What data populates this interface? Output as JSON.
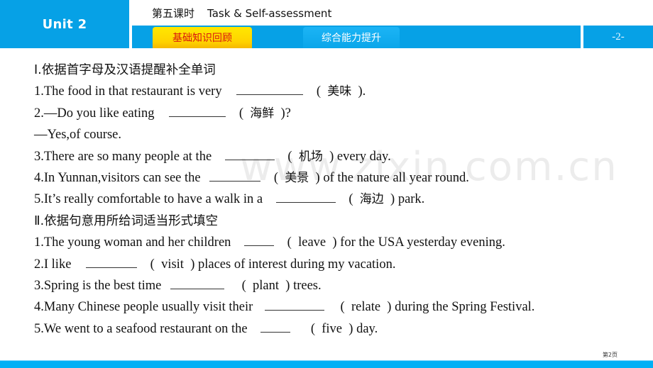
{
  "header": {
    "unit": "Unit 2",
    "lesson_cn": "第五课时",
    "lesson_en": "Task & Self-assessment",
    "tabs": [
      {
        "label": "基础知识回顾",
        "active": true
      },
      {
        "label": "综合能力提升",
        "active": false
      }
    ],
    "page_indicator": "-2-"
  },
  "section1": {
    "heading": "Ⅰ.依据首字母及汉语提醒补全单词",
    "items": [
      {
        "before": "1.The food in that restaurant is very",
        "hint": "美味",
        "after": "."
      },
      {
        "before": "2.—Do you like eating",
        "hint": "海鲜",
        "after": "?"
      },
      {
        "text": "—Yes,of course."
      },
      {
        "before": "3.There are so many people at the",
        "hint": "机场",
        "after": "every day."
      },
      {
        "before": "4.In Yunnan,visitors can see the",
        "hint": "美景",
        "after": "of the nature all year round."
      },
      {
        "before": "5.It’s really comfortable to have a walk in a",
        "hint": "海边",
        "after": "park."
      }
    ]
  },
  "section2": {
    "heading": "Ⅱ.依据句意用所给词适当形式填空",
    "items": [
      {
        "before": "1.The young woman and her children",
        "hint": "leave",
        "after": "for the USA yesterday evening."
      },
      {
        "before": "2.I like",
        "hint": "visit",
        "after": "places of interest during my vacation."
      },
      {
        "before": "3.Spring is the best time",
        "hint": "plant",
        "after": "trees."
      },
      {
        "before": "4.Many Chinese people usually visit their",
        "hint": "relate",
        "after": "during the Spring Festival."
      },
      {
        "before": "5.We went to a seafood restaurant on the",
        "hint": "five",
        "after": "day."
      }
    ]
  },
  "watermark": "www.zixin.com.cn",
  "footer": {
    "page_label": "第2页"
  },
  "colors": {
    "header_blue": "#06a1e6",
    "active_tab": "#ffd800",
    "active_tab_text": "#d8150f",
    "bottom_bar": "#00b0f5"
  }
}
